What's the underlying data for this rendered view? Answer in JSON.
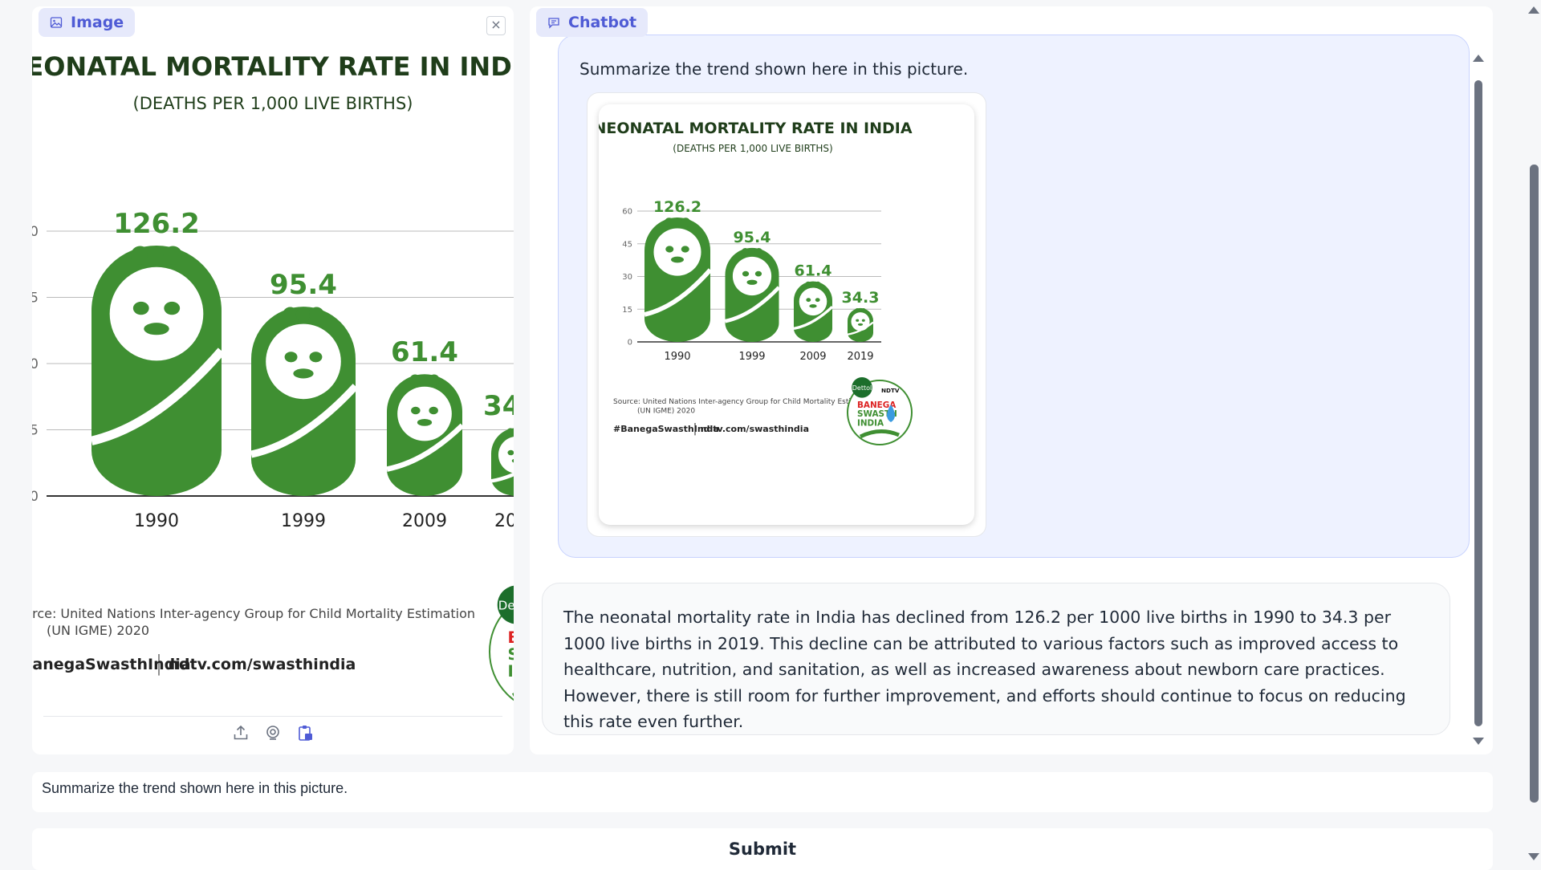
{
  "image_panel": {
    "label": "Image",
    "close": "×"
  },
  "chat_panel": {
    "label": "Chatbot"
  },
  "infographic": {
    "title": "NEONATAL MORTALITY RATE IN INDIA",
    "subtitle": "(DEATHS PER 1,000 LIVE BIRTHS)",
    "source_line1": "Source: United Nations Inter-agency Group for Child Mortality Estimation",
    "source_line2": "(UN IGME) 2020",
    "hashtag": "#BanegaSwasthIndia",
    "site": "ndtv.com/swasthindia",
    "logo_brand": "Dettol",
    "logo_partner": "NDTV",
    "logo_line1": "BANEGA",
    "logo_line2": "SWASTH",
    "logo_line3": "INDIA",
    "brand_green": "#3f8f32"
  },
  "chart_data": {
    "type": "bar",
    "title": "NEONATAL MORTALITY RATE IN INDIA",
    "subtitle": "(DEATHS PER 1,000 LIVE BIRTHS)",
    "categories": [
      "1990",
      "1999",
      "2009",
      "2019"
    ],
    "values": [
      126.2,
      95.4,
      61.4,
      34.3
    ],
    "value_labels": [
      "126.2",
      "95.4",
      "61.4",
      "34.3"
    ],
    "yticks": [
      "0",
      "15",
      "30",
      "45",
      "60"
    ],
    "ylim": [
      0,
      60
    ],
    "grid": true
  },
  "messages": {
    "user": "Summarize the trend shown here in this picture.",
    "bot": "The neonatal mortality rate in India has declined from 126.2 per 1000 live births in 1990 to 34.3 per 1000 live births in 2019. This decline can be attributed to various factors such as improved access to healthcare, nutrition, and sanitation, as well as increased awareness about newborn care practices. However, there is still room for further improvement, and efforts should continue to focus on reducing this rate even further."
  },
  "input": {
    "value": "Summarize the trend shown here in this picture."
  },
  "submit": {
    "label": "Submit"
  }
}
